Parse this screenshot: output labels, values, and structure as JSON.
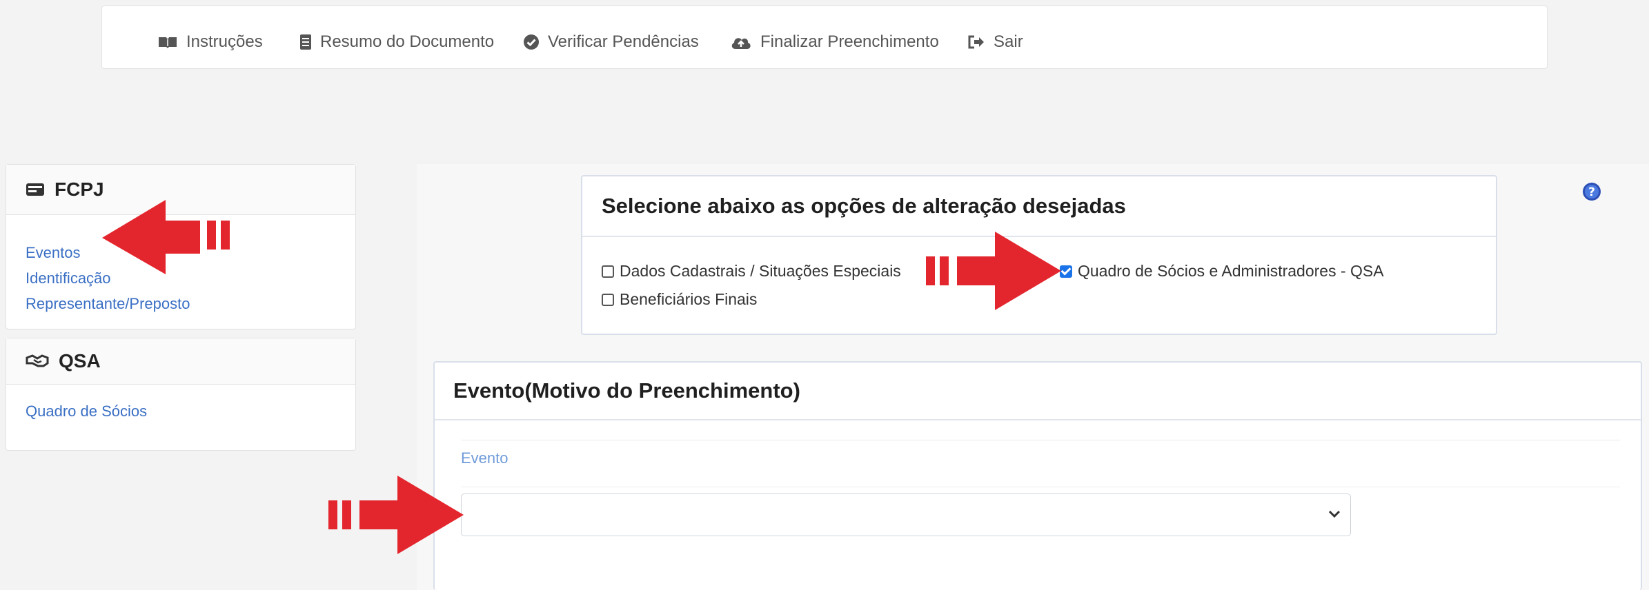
{
  "nav": {
    "items": [
      {
        "label": "Instruções",
        "icon": "book-icon"
      },
      {
        "label": "Resumo do Documento",
        "icon": "document-icon"
      },
      {
        "label": "Verificar Pendências",
        "icon": "check-circle-icon"
      },
      {
        "label": "Finalizar Preenchimento",
        "icon": "cloud-upload-icon"
      },
      {
        "label": "Sair",
        "icon": "sign-out-icon"
      }
    ]
  },
  "sidebar": {
    "fcpj": {
      "title": "FCPJ",
      "links": [
        "Eventos",
        "Identificação",
        "Representante/Preposto"
      ]
    },
    "qsa": {
      "title": "QSA",
      "links": [
        "Quadro de Sócios"
      ]
    }
  },
  "options_panel": {
    "title": "Selecione abaixo as opções de alteração desejadas",
    "checkboxes": [
      {
        "label": "Dados Cadastrais / Situações Especiais",
        "checked": false
      },
      {
        "label": "Beneficiários Finais",
        "checked": false
      },
      {
        "label": "Quadro de Sócios e Administradores - QSA",
        "checked": true
      }
    ]
  },
  "event_panel": {
    "title": "Evento(Motivo do Preenchimento)",
    "field_label": "Evento",
    "select_value": ""
  },
  "colors": {
    "accent": "#1a73e8",
    "link": "#3a6fc4",
    "arrow": "#e3262d"
  }
}
